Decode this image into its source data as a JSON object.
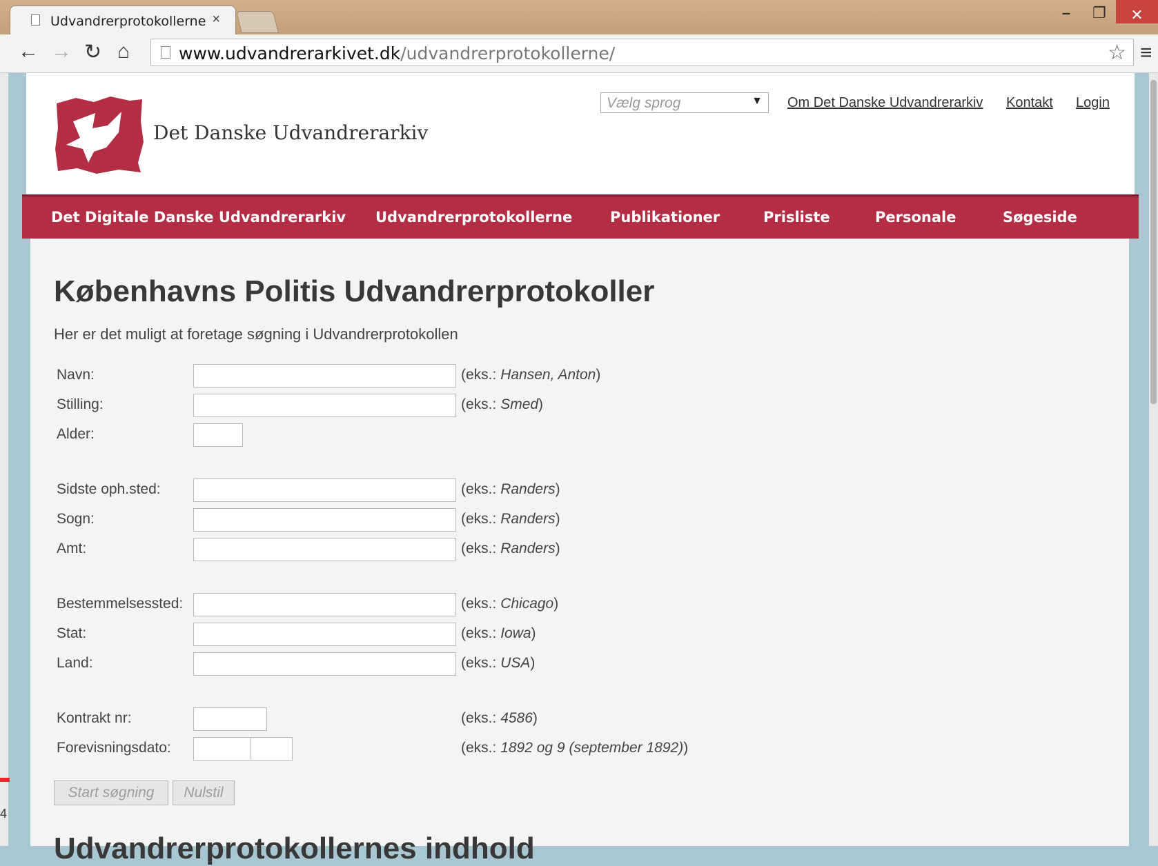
{
  "browser": {
    "tab_title": "Udvandrerprotokollerne",
    "tab_close": "×",
    "url_host": "www.udvandrerarkivet.dk",
    "url_path": "/udvandrerprotokollerne/",
    "icons": [
      "back-arrow-icon",
      "forward-arrow-icon",
      "reload-icon",
      "home-icon",
      "page-icon",
      "star-icon",
      "menu-icon"
    ],
    "win_min": "–",
    "win_max": "❐",
    "win_close": "✕"
  },
  "header": {
    "site_name": "Det Danske Udvandrerarkiv",
    "language_placeholder": "Vælg sprog",
    "links": {
      "about": "Om Det Danske Udvandrerarkiv",
      "contact": "Kontakt",
      "login": "Login"
    },
    "brand_color": "#b32e45"
  },
  "nav": {
    "items": [
      "Det Digitale Danske Udvandrerarkiv",
      "Udvandrerprotokollerne",
      "Publikationer",
      "Prisliste",
      "Personale",
      "Søgeside"
    ]
  },
  "main": {
    "title": "Københavns Politis Udvandrerprotokoller",
    "intro": "Her er det muligt at foretage søgning i Udvandrerprotokollen",
    "fields": {
      "navn": {
        "label": "Navn:",
        "ex_prefix": "(eks.: ",
        "ex_value": "Hansen, Anton",
        "ex_suffix": ")"
      },
      "stilling": {
        "label": "Stilling:",
        "ex_prefix": "(eks.: ",
        "ex_value": "Smed",
        "ex_suffix": ")"
      },
      "alder": {
        "label": "Alder:"
      },
      "sidste": {
        "label": "Sidste oph.sted:",
        "ex_prefix": "(eks.: ",
        "ex_value": "Randers",
        "ex_suffix": ")"
      },
      "sogn": {
        "label": "Sogn:",
        "ex_prefix": "(eks.: ",
        "ex_value": "Randers",
        "ex_suffix": ")"
      },
      "amt": {
        "label": "Amt:",
        "ex_prefix": "(eks.: ",
        "ex_value": "Randers",
        "ex_suffix": ")"
      },
      "bestemmelse": {
        "label": "Bestemmelsessted:",
        "ex_prefix": "(eks.: ",
        "ex_value": "Chicago",
        "ex_suffix": ")"
      },
      "stat": {
        "label": "Stat:",
        "ex_prefix": "(eks.: ",
        "ex_value": "Iowa",
        "ex_suffix": ")"
      },
      "land": {
        "label": "Land:",
        "ex_prefix": "(eks.: ",
        "ex_value": "USA",
        "ex_suffix": ")"
      },
      "kontrakt": {
        "label": "Kontrakt nr:",
        "ex_prefix": "(eks.: ",
        "ex_value": "4586",
        "ex_suffix": ")"
      },
      "dato": {
        "label": "Forevisningsdato:",
        "ex_prefix": "(eks.: ",
        "ex_value": "1892 og 9 (september 1892)",
        "ex_suffix": ")"
      }
    },
    "buttons": {
      "search": "Start søgning",
      "reset": "Nulstil"
    },
    "section_title": "Udvandrerprotokollernes indhold"
  },
  "misc": {
    "edge_char": "4"
  }
}
